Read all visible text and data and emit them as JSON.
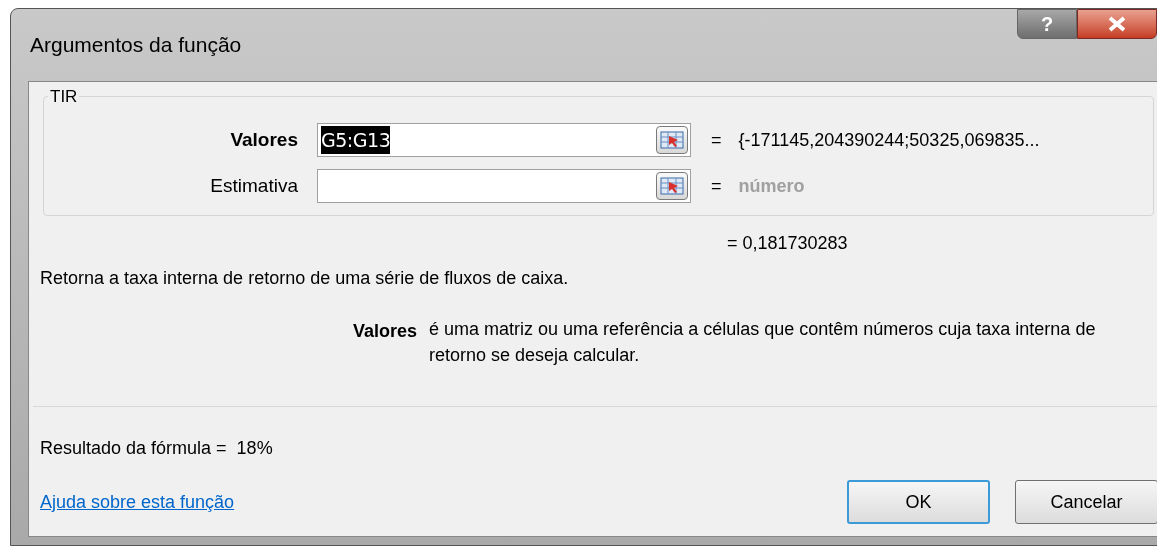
{
  "window": {
    "title": "Argumentos da função",
    "help_button": "?"
  },
  "function": {
    "name": "TIR",
    "arguments": [
      {
        "label": "Valores",
        "selected": true,
        "value": "G5:G13",
        "text_selected": true,
        "equals": "=",
        "result": "{-171145,204390244;50325,069835...",
        "kind": "value"
      },
      {
        "label": "Estimativa",
        "selected": false,
        "equals": "=",
        "result": "número",
        "kind": "hint"
      }
    ],
    "result": "= 0,181730283",
    "description": "Retorna a taxa interna de retorno de uma série de fluxos de caixa."
  },
  "argument_help": {
    "name": "Valores",
    "text": "é uma matriz ou uma referência a células que contêm números cuja taxa interna de retorno se deseja calcular."
  },
  "formula_result": "Resultado da fórmula =  18%",
  "help_link": "Ajuda sobre esta função",
  "buttons": [
    {
      "label": "OK",
      "selected": true
    },
    {
      "label": "Cancelar",
      "selected": false
    }
  ]
}
